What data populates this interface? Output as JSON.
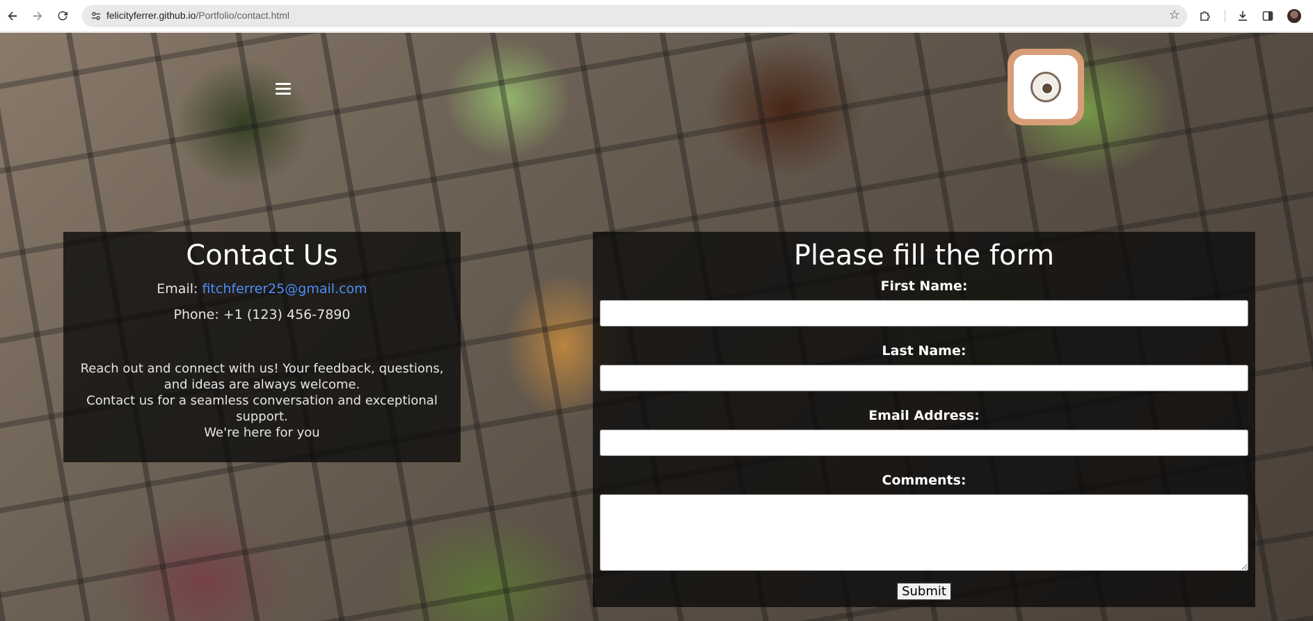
{
  "browser": {
    "url_host": "felicityferrer.github.io",
    "url_path": "/Portfolio/contact.html",
    "icons": {
      "back": "back-arrow-icon",
      "forward": "forward-arrow-icon",
      "reload": "reload-icon",
      "site_info": "site-info-icon",
      "bookmark": "star-icon",
      "extensions": "puzzle-icon",
      "downloads": "download-icon",
      "side_panel": "side-panel-icon",
      "profile": "profile-avatar"
    }
  },
  "header": {
    "menu_icon": "hamburger-menu-icon",
    "logo": "site-logo"
  },
  "contact": {
    "title": "Contact Us",
    "email_label": "Email:",
    "email": "fitchferrer25@gmail.com",
    "phone": "Phone: +1 (123) 456-7890",
    "message_line1": "Reach out and connect with us! Your feedback, questions, and ideas are always welcome.",
    "message_line2": "Contact us for a seamless conversation and exceptional support.",
    "message_line3": "We're here for you"
  },
  "form": {
    "title": "Please fill the form",
    "first_name_label": "First Name:",
    "first_name_value": "",
    "last_name_label": "Last Name:",
    "last_name_value": "",
    "email_label": "Email Address:",
    "email_value": "",
    "comments_label": "Comments:",
    "comments_value": "",
    "submit_label": "Submit"
  },
  "colors": {
    "panel_bg": "#0a0a0a",
    "link": "#4e8ef7",
    "logo_border": "#d89e77"
  }
}
